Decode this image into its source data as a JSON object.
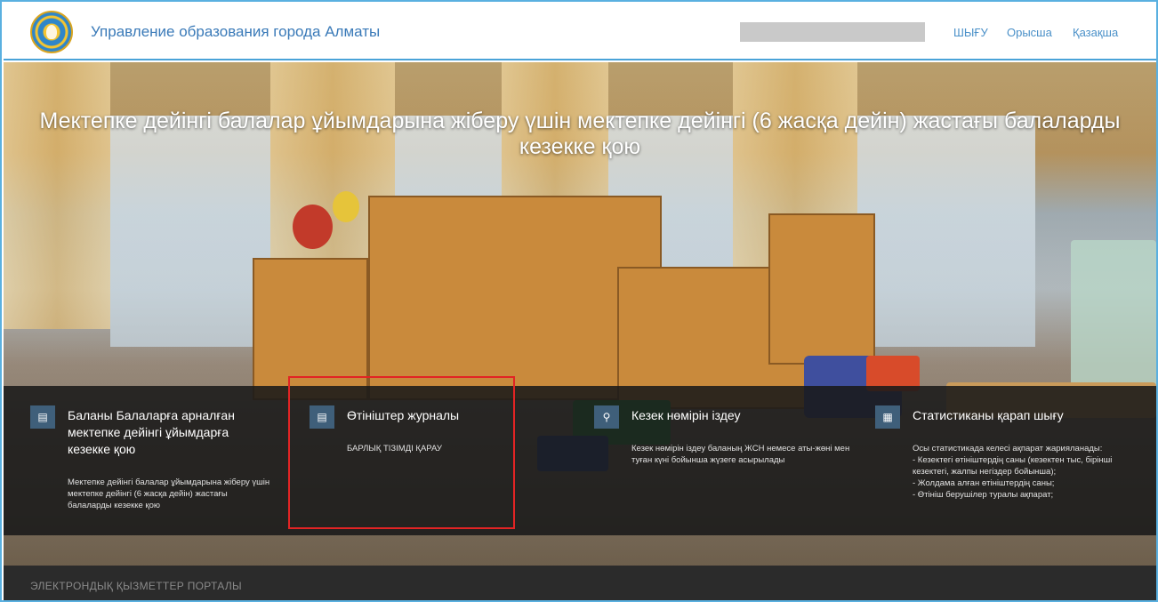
{
  "header": {
    "site_title": "Управление образования города Алматы",
    "nav": {
      "logout": "ШЫҒУ",
      "russian": "Орысша",
      "kazakh": "Қазақша"
    }
  },
  "hero": {
    "title": "Мектепке дейінгі балалар ұйымдарына жіберу үшін мектепке дейінгі (6 жасқа дейін) жастағы балаларды кезекке қою"
  },
  "cards": [
    {
      "icon": "folder-icon",
      "title": "Баланы Балаларға арналған мектепке дейінгі ұйымдарға кезекке қою",
      "desc": "Мектепке дейінгі балалар ұйымдарына жіберу үшін мектепке дейінгі (6 жасқа дейін) жастағы балаларды кезекке қою"
    },
    {
      "icon": "folder-icon",
      "title": "Өтініштер журналы",
      "desc": "БАРЛЫҚ ТІЗІМДІ ҚАРАУ"
    },
    {
      "icon": "search-icon",
      "title": "Кезек нөмірін іздеу",
      "desc": "Кезек нөмірін іздеу баланың ЖСН немесе аты-жөні мен туған күні бойынша жүзеге асырылады"
    },
    {
      "icon": "chart-icon",
      "title": "Статистиканы қарап шығу",
      "desc_lines": [
        "Осы статистикада келесі ақпарат жарияланады:",
        "- Кезектегі өтініштердің саны (кезектен тыс, бірінші кезектегі, жалпы негіздер бойынша);",
        "- Жолдама алған өтініштердің саны;",
        "- Өтініш берушілер туралы ақпарат;"
      ]
    }
  ],
  "footer": {
    "text": "ЭЛЕКТРОНДЫҚ ҚЫЗМЕТТЕР ПОРТАЛЫ"
  }
}
